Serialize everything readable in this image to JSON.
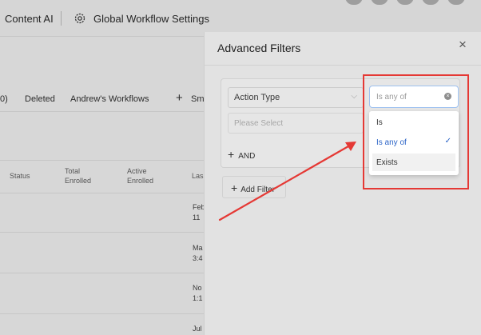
{
  "topbar": {
    "content_ai": "Content AI",
    "workflow_settings": "Global Workflow Settings"
  },
  "tabs": {
    "count_fragment": "0)",
    "deleted": "Deleted",
    "andrews": "Andrew's Workflows",
    "smart_fragment": "Sm"
  },
  "table": {
    "headers": [
      "Status",
      "Total\nEnrolled",
      "Active\nEnrolled",
      "Las"
    ],
    "last_col_fragments": [
      "Feb\n11",
      "Ma\n3:4",
      "No\n1:1",
      "Jul"
    ]
  },
  "drawer": {
    "title": "Advanced Filters",
    "close_symbol": "×",
    "field_select": "Action Type",
    "value_placeholder": "Please Select",
    "and_label": "AND",
    "add_filter_label": "Add Filter"
  },
  "operator": {
    "input_placeholder": "Is any of",
    "options": [
      {
        "label": "Is",
        "selected": false
      },
      {
        "label": "Is any of",
        "selected": true
      },
      {
        "label": "Exists",
        "selected": false
      }
    ]
  },
  "colors": {
    "highlight": "#e53935",
    "selected": "#2a63c7"
  }
}
